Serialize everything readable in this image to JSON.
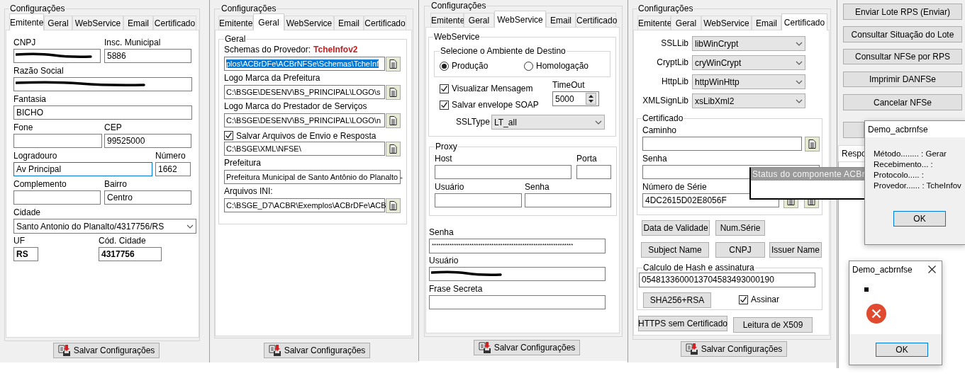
{
  "panels": [
    {
      "kind": "emitente",
      "group_title": "Configurações",
      "tabs": [
        {
          "label": "Emitente",
          "selected": true
        },
        {
          "label": "Geral",
          "selected": false
        },
        {
          "label": "WebService",
          "selected": false
        },
        {
          "label": "Email",
          "selected": false
        },
        {
          "label": "Certificado",
          "selected": false
        }
      ],
      "fields": [
        {
          "kind": "text",
          "label": "CNPJ",
          "redacted": true,
          "focused": false
        },
        {
          "kind": "text",
          "label": "Insc. Municipal",
          "value": "5886",
          "focused": false
        },
        {
          "kind": "text",
          "label": "Razão Social",
          "redacted": true,
          "focused": false
        },
        {
          "kind": "text",
          "label": "Fantasia",
          "value": "BICHO",
          "focused": false
        },
        {
          "kind": "text",
          "label": "Fone",
          "focused": false
        },
        {
          "kind": "text",
          "label": "CEP",
          "value": "99525000",
          "focused": false
        },
        {
          "kind": "text",
          "label": "Logradouro",
          "value": "Av Principal",
          "focused": true
        },
        {
          "kind": "text",
          "label": "Número",
          "value": "1662",
          "focused": false
        },
        {
          "kind": "text",
          "label": "Complemento",
          "focused": false
        },
        {
          "kind": "text",
          "label": "Bairro",
          "value": "Centro",
          "focused": false
        },
        {
          "kind": "combo",
          "label": "Cidade",
          "value": "Santo Antonio do Planalto/4317756/RS"
        },
        {
          "kind": "text",
          "label": "UF",
          "value": "RS",
          "focused": false
        },
        {
          "kind": "text",
          "label": "Cód. Cidade",
          "value": "4317756",
          "focused": false
        }
      ],
      "save_button": "Salvar Configurações"
    },
    {
      "kind": "geral",
      "group_title": "Configurações",
      "tabs": [
        {
          "label": "Emitente",
          "selected": false
        },
        {
          "label": "Geral",
          "selected": true
        },
        {
          "label": "WebService",
          "selected": false
        },
        {
          "label": "Email",
          "selected": false
        },
        {
          "label": "Certificado",
          "selected": false
        }
      ],
      "group_titles": [
        "Geral"
      ],
      "fields": [
        {
          "kind": "file",
          "label": "Schemas do Provedor:",
          "provider": "TcheInfov2",
          "value": "plos\\ACBrDFe\\ACBrNFSe\\Schemas\\TcheInf",
          "highlighted": true
        },
        {
          "kind": "file",
          "label": "Logo Marca da Prefeitura",
          "value": "C:\\BSGE\\DESENV\\BS_PRINCIPAL\\LOGO\\s",
          "highlighted": false
        },
        {
          "kind": "file",
          "label": "Logo Marca do Prestador de Serviços",
          "value": "C:\\BSGE\\DESENV\\BS_PRINCIPAL\\LOGO\\n",
          "highlighted": false
        },
        {
          "kind": "file",
          "check_label": "Salvar Arquivos de Envio e Resposta",
          "checked": true,
          "value": "C:\\BSGE\\XML\\NFSE\\",
          "highlighted": false
        },
        {
          "kind": "text",
          "label": "Prefeitura",
          "value": "Prefeitura Municipal de Santo Antônio do Planalto -",
          "highlighted": false
        },
        {
          "kind": "file",
          "label": "Arquivos INI:",
          "value": "C:\\BSGE_D7\\ACBR\\Exemplos\\ACBrDFe\\ACB",
          "highlighted": false
        }
      ],
      "save_button": "Salvar Configurações"
    },
    {
      "kind": "webservice",
      "group_title": "Configurações",
      "tabs": [
        {
          "label": "Emitente",
          "selected": false
        },
        {
          "label": "Geral",
          "selected": false
        },
        {
          "label": "WebService",
          "selected": true
        },
        {
          "label": "Email",
          "selected": false
        },
        {
          "label": "Certificado",
          "selected": false
        }
      ],
      "group_titles": [
        "WebService",
        "Selecione o Ambiente de Destino",
        "Proxy"
      ],
      "fields": [
        {
          "kind": "radio",
          "label": "Produção",
          "selected": true
        },
        {
          "kind": "radio",
          "label": "Homologação",
          "selected": false
        },
        {
          "kind": "check",
          "label": "Visualizar Mensagem",
          "checked": true
        },
        {
          "kind": "check",
          "label": "Salvar envelope SOAP",
          "checked": true
        },
        {
          "kind": "spin",
          "label": "TimeOut",
          "value": "5000"
        },
        {
          "kind": "combo",
          "label": "SSLType",
          "value": "LT_all"
        },
        {
          "kind": "text",
          "label": "Host"
        },
        {
          "kind": "text",
          "label": "Porta"
        },
        {
          "kind": "text",
          "label": "Usuário"
        },
        {
          "kind": "text",
          "label": "Senha"
        },
        {
          "kind": "password",
          "label": "Senha",
          "value": "****************************************************************"
        },
        {
          "kind": "text",
          "label": "Usuário",
          "redacted": true
        },
        {
          "kind": "text",
          "label": "Frase Secreta"
        }
      ],
      "save_button": "Salvar Configurações"
    },
    {
      "kind": "certificado",
      "group_title": "Configurações",
      "tabs": [
        {
          "label": "Emitente",
          "selected": false
        },
        {
          "label": "Geral",
          "selected": false
        },
        {
          "label": "WebService",
          "selected": false
        },
        {
          "label": "Email",
          "selected": false
        },
        {
          "label": "Certificado",
          "selected": true
        }
      ],
      "group_titles": [
        "Certificado",
        "Calculo de Hash e assinatura"
      ],
      "fields": [
        {
          "kind": "combo",
          "label": "SSLLib",
          "value": "libWinCrypt"
        },
        {
          "kind": "combo",
          "label": "CryptLib",
          "value": "cryWinCrypt"
        },
        {
          "kind": "combo",
          "label": "HttpLib",
          "value": "httpWinHttp"
        },
        {
          "kind": "combo",
          "label": "XMLSignLib",
          "value": "xsLibXml2"
        },
        {
          "kind": "file",
          "label": "Caminho"
        },
        {
          "kind": "text",
          "label": "Senha"
        },
        {
          "kind": "file",
          "label": "Número de Série",
          "value": "4DC2615D02E8056F"
        },
        {
          "kind": "button",
          "label": "Data de Validade"
        },
        {
          "kind": "button",
          "label": "Num.Série"
        },
        {
          "kind": "button",
          "label": "Subject Name"
        },
        {
          "kind": "button",
          "label": "CNPJ"
        },
        {
          "kind": "button",
          "label": "Issuer Name"
        },
        {
          "kind": "text",
          "value": "0548133600013704583493000190"
        },
        {
          "kind": "button",
          "label": "SHA256+RSA"
        },
        {
          "kind": "check",
          "label": "Assinar",
          "checked": true
        },
        {
          "kind": "button",
          "label": "HTTPS sem Certificado"
        },
        {
          "kind": "button",
          "label": "Leitura de X509"
        }
      ],
      "save_button": "Salvar Configurações"
    }
  ],
  "actions": [
    "Enviar Lote RPS (Enviar)",
    "Consultar Situação do Lote",
    "Consultar NFSe por RPS",
    "Imprimir DANFSe",
    "Cancelar NFSe"
  ],
  "response_tab": "Respo",
  "status_window": {
    "title": "Status do componente ACBr"
  },
  "dialogs": [
    {
      "kind": "info",
      "title": "Demo_acbrnfse",
      "lines": [
        "Método........ : Gerar",
        "Recebimento... :",
        "Protocolo..... :",
        "Provedor...... : TcheInfov"
      ],
      "button": "OK"
    },
    {
      "kind": "error",
      "title": "Demo_acbrnfse",
      "button": "OK"
    }
  ]
}
